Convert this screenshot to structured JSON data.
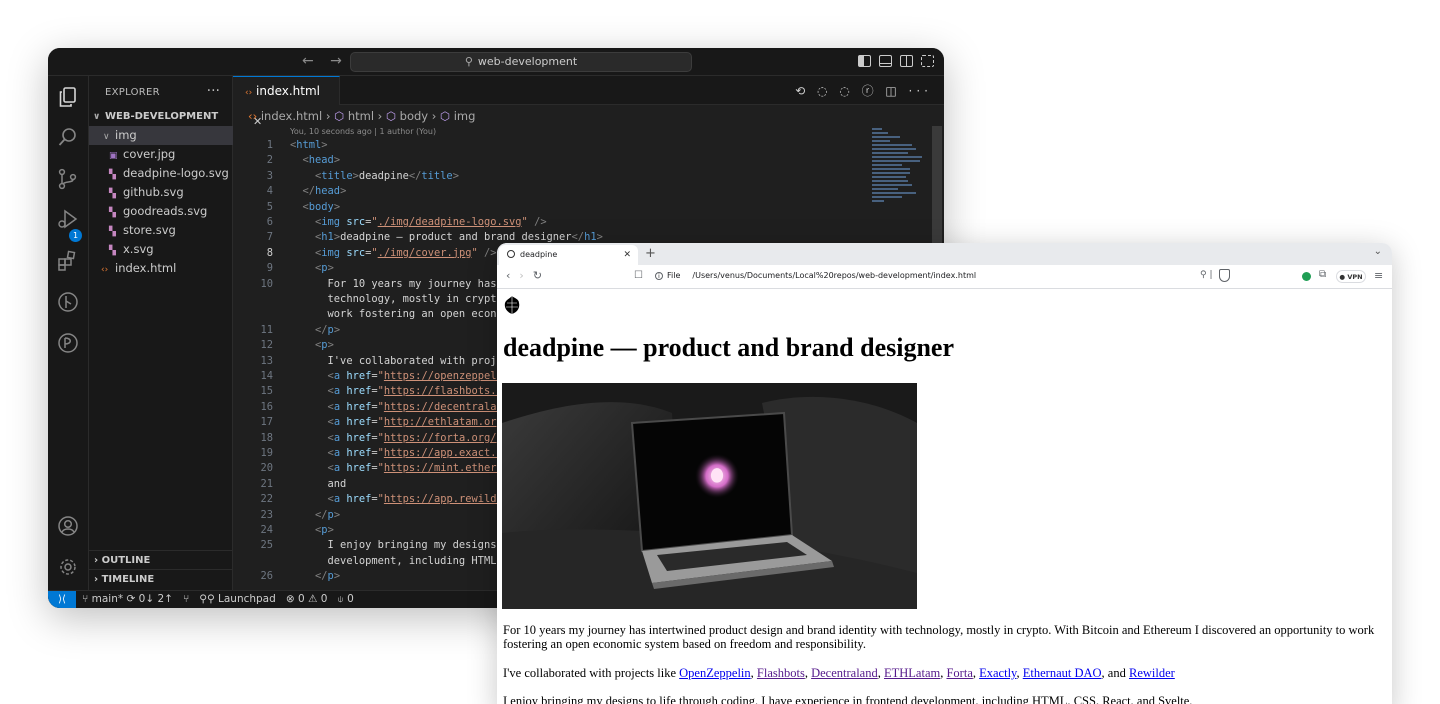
{
  "vscode": {
    "search": "web-development",
    "explorer_title": "EXPLORER",
    "workspace": "WEB-DEVELOPMENT",
    "source_control_badge": "1",
    "tree": [
      {
        "label": "img",
        "kind": "folder"
      },
      {
        "label": "cover.jpg",
        "kind": "img"
      },
      {
        "label": "deadpine-logo.svg",
        "kind": "svg"
      },
      {
        "label": "github.svg",
        "kind": "svg"
      },
      {
        "label": "goodreads.svg",
        "kind": "svg"
      },
      {
        "label": "store.svg",
        "kind": "svg"
      },
      {
        "label": "x.svg",
        "kind": "svg"
      },
      {
        "label": "index.html",
        "kind": "html"
      }
    ],
    "outline": "OUTLINE",
    "timeline": "TIMELINE",
    "tab": "index.html",
    "breadcrumb": [
      "index.html",
      "html",
      "body",
      "img"
    ],
    "blame": "You, 10 seconds ago | 1 author (You)",
    "active_line": "8",
    "status": {
      "branch": "main*",
      "sync": "0↓ 2↑",
      "launchpad": "Launchpad",
      "problems": "⊗ 0 ⚠ 0",
      "ports": "0"
    }
  },
  "browser": {
    "tab_title": "deadpine",
    "url_scheme": "File",
    "url": "/Users/venus/Documents/Local%20repos/web-development/index.html",
    "vpn": "VPN",
    "page": {
      "h1": "deadpine — product and brand designer",
      "p1": "For 10 years my journey has intertwined product design and brand identity with technology, mostly in crypto. With Bitcoin and Ethereum I discovered an opportunity to work fostering an open economic system based on freedom and responsibility.",
      "p2_intro": "I've collaborated with projects like ",
      "p2_links": [
        "OpenZeppelin",
        "Flashbots",
        "Decentraland",
        "ETHLatam",
        "Forta",
        "Exactly",
        "Ethernaut DAO"
      ],
      "p2_and": ", and ",
      "p2_last": "Rewilder",
      "p3": "I enjoy bringing my designs to life through coding. I have experience in frontend development, including HTML, CSS, React, and Svelte."
    }
  }
}
